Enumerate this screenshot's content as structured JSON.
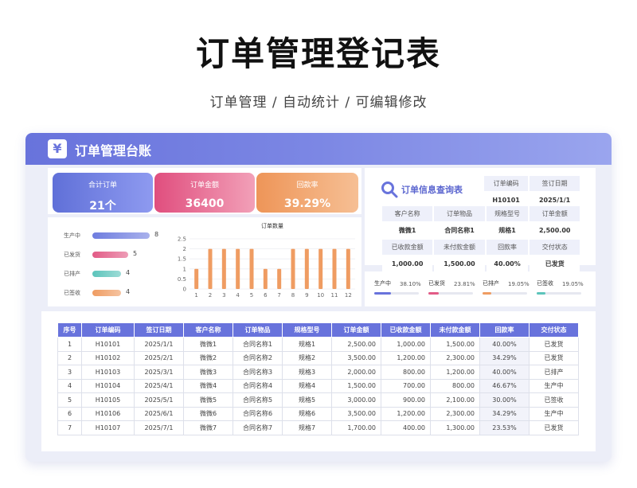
{
  "page": {
    "title": "订单管理登记表",
    "subtitle": "订单管理  /  自动统计  /  可编辑修改"
  },
  "banner": {
    "icon": "¥",
    "title": "订单管理台账"
  },
  "kpis": [
    {
      "label": "合计订单",
      "value": "21个"
    },
    {
      "label": "订单金额",
      "value": "36400"
    },
    {
      "label": "回款率",
      "value": "39.29%"
    }
  ],
  "status_bars": [
    {
      "label": "生产中",
      "value": 8,
      "color": "#6f7ddf"
    },
    {
      "label": "已发货",
      "value": 5,
      "color": "#e25b86"
    },
    {
      "label": "已排产",
      "value": 4,
      "color": "#5cc4bb"
    },
    {
      "label": "已签收",
      "value": 4,
      "color": "#ef9c62"
    }
  ],
  "chart_data": {
    "type": "bar",
    "title": "订单数量",
    "categories": [
      "1",
      "2",
      "3",
      "4",
      "5",
      "6",
      "7",
      "8",
      "9",
      "10",
      "11",
      "12"
    ],
    "values": [
      1,
      2,
      2,
      2,
      2,
      1,
      1,
      2,
      2,
      2,
      2,
      2
    ],
    "y_ticks": [
      "0",
      "0.5",
      "1",
      "1.5",
      "2",
      "2.5"
    ],
    "ylim": [
      0,
      2.5
    ],
    "grid": true,
    "bar_color": "#ef9c62"
  },
  "query": {
    "title": "订单信息查询表",
    "rows": [
      [
        {
          "text": "订单编码",
          "kind": "lbl"
        },
        {
          "text": "签订日期",
          "kind": "lbl"
        }
      ],
      [
        {
          "text": "H10101",
          "kind": "val"
        },
        {
          "text": "2025/1/1",
          "kind": "val"
        }
      ]
    ],
    "grid": [
      [
        "客户名称",
        "订单物品",
        "规格型号",
        "订单金额"
      ],
      [
        "微微1",
        "合同名称1",
        "规格1",
        "2,500.00"
      ],
      [
        "已收款金额",
        "未付款金额",
        "回款率",
        "交付状态"
      ],
      [
        "1,000.00",
        "1,500.00",
        "40.00%",
        "已发货"
      ]
    ]
  },
  "progress": [
    {
      "label": "生产中",
      "pct": "38.10%",
      "value": 0.381,
      "color": "#6873dc"
    },
    {
      "label": "已发货",
      "pct": "23.81%",
      "value": 0.2381,
      "color": "#e25b86"
    },
    {
      "label": "已排产",
      "pct": "19.05%",
      "value": 0.1905,
      "color": "#ef9c62"
    },
    {
      "label": "已签收",
      "pct": "19.05%",
      "value": 0.1905,
      "color": "#5cc4bb"
    }
  ],
  "orders": {
    "columns": [
      "序号",
      "订单编码",
      "签订日期",
      "客户名称",
      "订单物品",
      "规格型号",
      "订单金额",
      "已收款金额",
      "未付款金额",
      "回款率",
      "交付状态"
    ],
    "rows": [
      [
        "1",
        "H10101",
        "2025/1/1",
        "微微1",
        "合同名称1",
        "规格1",
        "2,500.00",
        "1,000.00",
        "1,500.00",
        "40.00%",
        "已发货"
      ],
      [
        "2",
        "H10102",
        "2025/2/1",
        "微微2",
        "合同名称2",
        "规格2",
        "3,500.00",
        "1,200.00",
        "2,300.00",
        "34.29%",
        "已发货"
      ],
      [
        "3",
        "H10103",
        "2025/3/1",
        "微微3",
        "合同名称3",
        "规格3",
        "2,000.00",
        "800.00",
        "1,200.00",
        "40.00%",
        "已排产"
      ],
      [
        "4",
        "H10104",
        "2025/4/1",
        "微微4",
        "合同名称4",
        "规格4",
        "1,500.00",
        "700.00",
        "800.00",
        "46.67%",
        "生产中"
      ],
      [
        "5",
        "H10105",
        "2025/5/1",
        "微微5",
        "合同名称5",
        "规格5",
        "3,000.00",
        "900.00",
        "2,100.00",
        "30.00%",
        "已签收"
      ],
      [
        "6",
        "H10106",
        "2025/6/1",
        "微微6",
        "合同名称6",
        "规格6",
        "3,500.00",
        "1,200.00",
        "2,300.00",
        "34.29%",
        "生产中"
      ],
      [
        "7",
        "H10107",
        "2025/7/1",
        "微微7",
        "合同名称7",
        "规格7",
        "1,700.00",
        "400.00",
        "1,300.00",
        "23.53%",
        "已发货"
      ]
    ]
  }
}
